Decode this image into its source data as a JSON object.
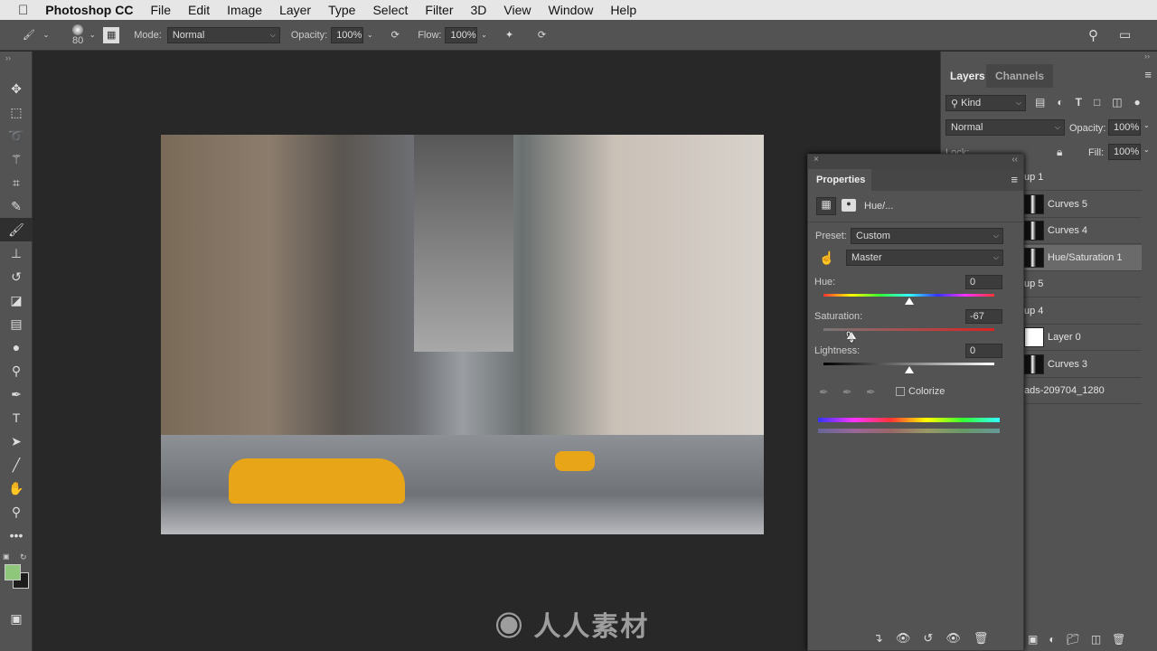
{
  "menubar": {
    "app": "Photoshop CC",
    "items": [
      "File",
      "Edit",
      "Image",
      "Layer",
      "Type",
      "Select",
      "Filter",
      "3D",
      "View",
      "Window",
      "Help"
    ]
  },
  "options": {
    "brush_size": "80",
    "mode_label": "Mode:",
    "mode": "Normal",
    "opacity_label": "Opacity:",
    "opacity": "100%",
    "flow_label": "Flow:",
    "flow": "100%"
  },
  "tools": [
    "move-icon",
    "marquee-icon",
    "lasso-icon",
    "magic-wand-icon",
    "crop-icon",
    "eyedropper-icon",
    "brush-icon",
    "stamp-icon",
    "history-brush-icon",
    "eraser-icon",
    "gradient-icon",
    "blur-icon",
    "dodge-icon",
    "pen-icon",
    "type-icon",
    "path-select-icon",
    "line-icon",
    "hand-icon",
    "zoom-icon",
    "more-icon"
  ],
  "colors": {
    "foreground": "#8fc77a",
    "background": "#1c1c1c",
    "accent_taxi": "#e8a518"
  },
  "layers": {
    "tabs": [
      "Layers",
      "Channels"
    ],
    "filter": "Kind",
    "blend": "Normal",
    "opacity_label": "Opacity:",
    "opacity": "100%",
    "lock_label": "Lock:",
    "fill_label": "Fill:",
    "fill": "100%",
    "rows": [
      {
        "name": "up 1",
        "thumb": false
      },
      {
        "name": "Curves 5",
        "thumb": true
      },
      {
        "name": "Curves 4",
        "thumb": true
      },
      {
        "name": "Hue/Saturation 1",
        "thumb": true,
        "selected": true
      },
      {
        "name": "up 5",
        "thumb": false
      },
      {
        "name": "up 4",
        "thumb": false
      },
      {
        "name": "Layer 0",
        "thumb": true
      },
      {
        "name": "Curves 3",
        "thumb": true
      },
      {
        "name": "ads-209704_1280",
        "thumb": false
      }
    ]
  },
  "properties": {
    "title": "Properties",
    "adjustment": "Hue/...",
    "preset_label": "Preset:",
    "preset": "Custom",
    "channel": "Master",
    "hue_label": "Hue:",
    "hue": "0",
    "saturation_label": "Saturation:",
    "saturation": "-67",
    "lightness_label": "Lightness:",
    "lightness": "0",
    "colorize_label": "Colorize",
    "colorize": false
  },
  "watermark": "人人素材"
}
